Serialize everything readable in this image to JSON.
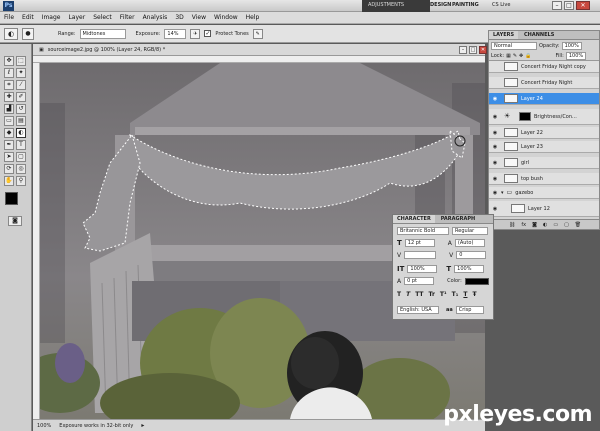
{
  "app": {
    "logo": "Ps",
    "workspaces": [
      "DESIGN",
      "PAINTING"
    ],
    "cs_live": "CS Live"
  },
  "adjust_panel": {
    "label": "ADJUSTMENTS"
  },
  "menu": [
    "File",
    "Edit",
    "Image",
    "Layer",
    "Select",
    "Filter",
    "Analysis",
    "3D",
    "View",
    "Window",
    "Help"
  ],
  "options": {
    "range_label": "Range:",
    "range_value": "Midtones",
    "exposure_label": "Exposure:",
    "exposure_value": "14%",
    "protect_tones": "Protect Tones"
  },
  "document": {
    "tab": "sourceimage2.jpg @ 100% (Layer 24, RGB/8) *"
  },
  "status": {
    "zoom": "100%",
    "message": "Exposure works in 32-bit only"
  },
  "layers": {
    "tabs": [
      "LAYERS",
      "CHANNELS"
    ],
    "blend_mode": "Normal",
    "opacity_label": "Opacity:",
    "opacity": "100%",
    "lock_label": "Lock:",
    "fill_label": "Fill:",
    "fill": "100%",
    "items": [
      {
        "name": "Concert Friday Night copy"
      },
      {
        "name": "Concert Friday Night"
      },
      {
        "name": "Layer 24",
        "selected": true
      },
      {
        "name": "Brightness/Con..."
      },
      {
        "name": "Layer 22"
      },
      {
        "name": "Layer 23"
      },
      {
        "name": "girl"
      },
      {
        "name": "top bush"
      },
      {
        "name": "gazebo"
      },
      {
        "name": "Layer 12"
      }
    ]
  },
  "character": {
    "tabs": [
      "CHARACTER",
      "PARAGRAPH"
    ],
    "font": "Britannic Bold",
    "style": "Regular",
    "size": "12 pt",
    "leading": "(Auto)",
    "tracking": "0",
    "vscale": "100%",
    "hscale": "100%",
    "baseline": "0 pt",
    "color_label": "Color:",
    "language": "English: USA",
    "aa_label": "aa",
    "antialias": "Crisp",
    "style_buttons": [
      "T",
      "T",
      "TT",
      "Tr",
      "T¹",
      "T₁",
      "T",
      "Ŧ"
    ]
  },
  "watermark": "pxleyes.com",
  "colors": {
    "selected_layer": "#3d8ee6",
    "canvas_bg": "#7d797c"
  }
}
